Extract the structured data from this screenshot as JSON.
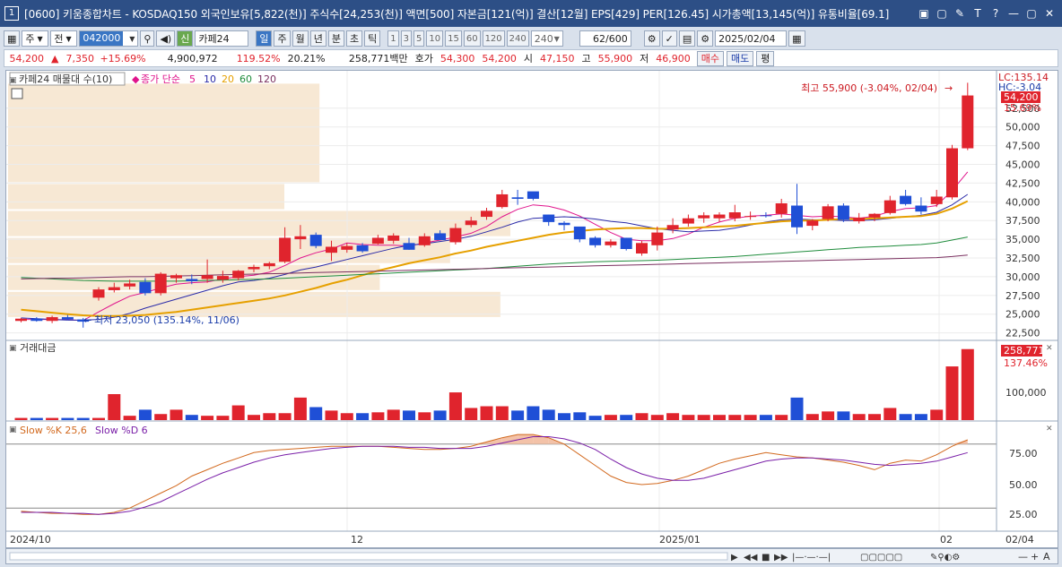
{
  "window": {
    "number": "1",
    "title": "[0600] 키움종합차트 - KOSDAQ150 외국인보유[5,822(천)] 주식수[24,253(천)] 액면[500] 자본금[121(억)] 결산[12월] EPS[429] PER[126.45] 시가총액[13,145(억)] 유통비율[69.1]",
    "buttons": [
      "▣",
      "▢",
      "✎",
      "T",
      "?",
      "—",
      "▢",
      "✕"
    ]
  },
  "toolbar": {
    "period_main": "주",
    "period_prev": "전",
    "code": "042000",
    "shin_label": "신",
    "stock_name": "카페24",
    "period_buttons": [
      "일",
      "주",
      "월",
      "년",
      "분",
      "초",
      "틱"
    ],
    "period_active": "일",
    "interval_buttons": [
      "1",
      "3",
      "5",
      "10",
      "15",
      "60",
      "120",
      "240"
    ],
    "interval_select": "240",
    "count": "62",
    "count_total": "/600",
    "date": "2025/02/04"
  },
  "quote": {
    "price": "54,200",
    "arrow": "▲",
    "change": "7,350",
    "change_rate": "+15.69%",
    "volume": "4,900,972",
    "volume_rate": "119.52%",
    "turnover": "20.21%",
    "amount": "258,771백만",
    "bid_label": "호가",
    "ask": "54,300",
    "bid": "54,200",
    "open_label": "시",
    "open": "47,150",
    "high_label": "고",
    "high": "55,900",
    "low_label": "저",
    "low": "46,900",
    "buy_button": "매수",
    "sell_button": "매도",
    "eval_button": "평"
  },
  "chart": {
    "legend_name": "카페24 매물대 수(10)",
    "ma_label": "종가 단순",
    "ma_periods": [
      "5",
      "10",
      "20",
      "60",
      "120"
    ],
    "ma_colors": [
      "#e0148c",
      "#2a2aa8",
      "#e6a000",
      "#1f8c3c",
      "#7a2f5f"
    ],
    "max_annotation": "최고 55,900 (-3.04%, 02/04)",
    "min_annotation": "최저 23,050 (135.14%, 11/06)",
    "lc_label": "LC:135.14",
    "hc_label": "HC:-3.04",
    "price_badge": "54,200",
    "price_badge_rate": "15.69%",
    "volume_title": "거래대금",
    "volume_badge": "258,771",
    "volume_badge_rate": "137.46%",
    "volume_tick": "100,000",
    "stoch_label_k": "Slow %K 25,6",
    "stoch_label_d": "Slow %D 6",
    "stoch_ticks": [
      "75.00",
      "50.00",
      "25.00"
    ],
    "x_labels": [
      "2024/10",
      "12",
      "2025/01",
      "02",
      "02/04"
    ]
  },
  "chart_data": {
    "type": "candlestick",
    "ylim": [
      21500,
      57500
    ],
    "yticks": [
      "52,500",
      "50,000",
      "47,500",
      "45,000",
      "42,500",
      "40,000",
      "37,500",
      "35,000",
      "32,500",
      "30,000",
      "27,500",
      "25,000",
      "22,500"
    ],
    "candles": [
      [
        24100,
        24500,
        23900,
        24400
      ],
      [
        24400,
        24600,
        24000,
        24100
      ],
      [
        24100,
        24800,
        23800,
        24600
      ],
      [
        24600,
        24900,
        24200,
        24300
      ],
      [
        24300,
        24500,
        23200,
        24000
      ],
      [
        27200,
        28600,
        26800,
        28300
      ],
      [
        28200,
        29200,
        27900,
        28600
      ],
      [
        28700,
        29600,
        28300,
        29100
      ],
      [
        29300,
        29800,
        27500,
        27800
      ],
      [
        27800,
        30600,
        27500,
        30400
      ],
      [
        29800,
        30400,
        29200,
        30200
      ],
      [
        29700,
        30300,
        29000,
        29400
      ],
      [
        29700,
        32300,
        29200,
        30200
      ],
      [
        29600,
        30800,
        29200,
        30100
      ],
      [
        29800,
        30900,
        29500,
        30800
      ],
      [
        31000,
        31600,
        30600,
        31300
      ],
      [
        31400,
        32000,
        31000,
        31800
      ],
      [
        32000,
        36600,
        31800,
        35200
      ],
      [
        35000,
        36900,
        33700,
        35400
      ],
      [
        35600,
        35900,
        33800,
        34100
      ],
      [
        33200,
        34800,
        32100,
        34000
      ],
      [
        33600,
        34500,
        33200,
        34100
      ],
      [
        34200,
        34500,
        33200,
        33400
      ],
      [
        34400,
        35600,
        34300,
        35200
      ],
      [
        34800,
        35800,
        34400,
        35500
      ],
      [
        34500,
        35200,
        33600,
        33600
      ],
      [
        34200,
        35800,
        34000,
        35400
      ],
      [
        35800,
        36200,
        34900,
        34900
      ],
      [
        34600,
        37100,
        34300,
        36500
      ],
      [
        36900,
        38000,
        36600,
        37500
      ],
      [
        38000,
        39200,
        37600,
        38800
      ],
      [
        39300,
        41600,
        39100,
        41000
      ],
      [
        40600,
        41600,
        39600,
        40400
      ],
      [
        41400,
        41300,
        40200,
        40400
      ],
      [
        38300,
        38300,
        36800,
        37300
      ],
      [
        37200,
        37400,
        36200,
        36900
      ],
      [
        36700,
        36500,
        34600,
        35000
      ],
      [
        35200,
        35400,
        33900,
        34200
      ],
      [
        34200,
        35000,
        33900,
        34700
      ],
      [
        35200,
        35200,
        33500,
        33700
      ],
      [
        33100,
        34800,
        32800,
        34500
      ],
      [
        34200,
        36700,
        33500,
        35900
      ],
      [
        36300,
        37800,
        35800,
        36900
      ],
      [
        37100,
        38300,
        36700,
        37800
      ],
      [
        37800,
        38600,
        37200,
        38200
      ],
      [
        37800,
        38600,
        37300,
        38300
      ],
      [
        37800,
        39600,
        37400,
        38600
      ],
      [
        38100,
        38700,
        37600,
        38100
      ],
      [
        38200,
        38600,
        37900,
        38100
      ],
      [
        38400,
        40400,
        37900,
        39800
      ],
      [
        39500,
        42400,
        35700,
        36600
      ],
      [
        36800,
        37700,
        36200,
        37500
      ],
      [
        37700,
        39700,
        37400,
        39400
      ],
      [
        39500,
        39800,
        37300,
        37600
      ],
      [
        37400,
        38500,
        37100,
        37900
      ],
      [
        37900,
        38500,
        37400,
        38400
      ],
      [
        38500,
        40800,
        38300,
        40200
      ],
      [
        40800,
        41600,
        39500,
        39700
      ],
      [
        39500,
        40600,
        38300,
        38700
      ],
      [
        39700,
        41600,
        39300,
        40700
      ],
      [
        40600,
        47600,
        40300,
        47150
      ],
      [
        47150,
        55900,
        46900,
        54200
      ]
    ],
    "amounts": [
      2.5,
      2.5,
      2.5,
      2.5,
      2.5,
      2.5,
      30,
      5,
      12,
      7,
      12,
      6,
      5,
      5,
      17,
      6,
      8,
      8,
      26,
      15,
      11,
      8,
      8,
      9,
      12,
      11,
      9,
      11,
      32,
      14,
      16,
      16,
      11,
      16,
      12,
      8,
      9,
      5,
      6,
      6,
      8,
      6,
      8,
      6,
      6,
      6,
      6,
      6,
      6,
      6,
      26,
      7,
      10,
      10,
      7,
      7,
      14,
      7,
      7,
      12,
      62,
      82
    ],
    "ma": {
      "5": [
        24300,
        24300,
        24300,
        24250,
        24150,
        25300,
        26400,
        27400,
        27900,
        28500,
        29000,
        29200,
        29300,
        29700,
        30000,
        30200,
        30600,
        31500,
        32500,
        33200,
        33700,
        34500,
        34300,
        34200,
        34200,
        34100,
        34500,
        34900,
        35300,
        35800,
        36700,
        38000,
        39000,
        39600,
        39400,
        38900,
        38100,
        37000,
        35900,
        35000,
        34800,
        34800,
        35100,
        35700,
        36600,
        37300,
        37800,
        38100,
        38200,
        38400,
        38200,
        38000,
        38100,
        38000,
        37800,
        38100,
        38700,
        39100,
        39200,
        39500,
        41500,
        44000
      ],
      "10": [
        24500,
        24400,
        24300,
        24200,
        24200,
        24300,
        24600,
        25100,
        25800,
        26400,
        27000,
        27600,
        28200,
        28800,
        29300,
        29500,
        29800,
        30300,
        30900,
        31300,
        31800,
        32300,
        32800,
        33300,
        33800,
        34200,
        34400,
        34700,
        35000,
        35400,
        36000,
        36600,
        37300,
        37800,
        37900,
        38000,
        37900,
        37700,
        37400,
        37200,
        36800,
        36400,
        36200,
        36000,
        36100,
        36200,
        36500,
        36900,
        37300,
        37600,
        37700,
        37600,
        37600,
        37500,
        37500,
        37600,
        37800,
        38000,
        38200,
        38600,
        39600,
        41000
      ],
      "20": [
        25600,
        25400,
        25200,
        25000,
        24850,
        24750,
        24750,
        24800,
        24900,
        25100,
        25300,
        25600,
        25900,
        26200,
        26500,
        26800,
        27100,
        27500,
        28000,
        28500,
        29100,
        29600,
        30200,
        30800,
        31300,
        31800,
        32200,
        32600,
        33100,
        33500,
        34000,
        34400,
        34800,
        35200,
        35600,
        35900,
        36100,
        36300,
        36400,
        36500,
        36500,
        36400,
        36400,
        36500,
        36600,
        36700,
        36800,
        37000,
        37200,
        37400,
        37500,
        37500,
        37600,
        37700,
        37700,
        37800,
        37900,
        38000,
        38100,
        38400,
        39100,
        40100
      ],
      "60": [
        29900,
        29800,
        29700,
        29600,
        29500,
        29450,
        29400,
        29400,
        29400,
        29400,
        29400,
        29450,
        29500,
        29550,
        29600,
        29650,
        29700,
        29800,
        29900,
        30000,
        30100,
        30200,
        30300,
        30400,
        30500,
        30600,
        30700,
        30800,
        30900,
        31000,
        31100,
        31250,
        31400,
        31550,
        31700,
        31800,
        31900,
        32000,
        32050,
        32100,
        32150,
        32200,
        32300,
        32400,
        32500,
        32600,
        32700,
        32850,
        33000,
        33150,
        33300,
        33450,
        33600,
        33750,
        33900,
        34000,
        34100,
        34200,
        34300,
        34500,
        34900,
        35300
      ],
      "120": [
        29700,
        29750,
        29800,
        29800,
        29850,
        29900,
        29950,
        30000,
        30000,
        30050,
        30100,
        30150,
        30200,
        30250,
        30300,
        30350,
        30400,
        30450,
        30500,
        30550,
        30600,
        30650,
        30700,
        30750,
        30800,
        30850,
        30900,
        30950,
        31000,
        31050,
        31100,
        31150,
        31200,
        31250,
        31300,
        31350,
        31400,
        31450,
        31500,
        31550,
        31600,
        31650,
        31700,
        31750,
        31800,
        31850,
        31900,
        31950,
        32000,
        32050,
        32100,
        32150,
        32200,
        32250,
        32300,
        32350,
        32400,
        32450,
        32500,
        32550,
        32700,
        32900
      ]
    },
    "stoch_k": [
      17,
      16,
      15,
      15,
      14,
      14,
      16,
      20,
      27,
      34,
      41,
      50,
      56,
      62,
      67,
      72,
      74,
      75,
      76,
      77,
      78,
      78,
      78,
      78,
      77,
      76,
      75,
      75,
      76,
      78,
      82,
      86,
      89,
      89,
      86,
      80,
      70,
      60,
      50,
      44,
      42,
      43,
      46,
      50,
      56,
      62,
      66,
      69,
      72,
      70,
      68,
      67,
      65,
      63,
      60,
      56,
      62,
      65,
      64,
      70,
      78,
      84
    ],
    "stoch_d": [
      16,
      16,
      16,
      15,
      15,
      14,
      15,
      17,
      21,
      26,
      33,
      40,
      47,
      53,
      58,
      63,
      67,
      70,
      72,
      74,
      76,
      77,
      78,
      78,
      78,
      77,
      77,
      76,
      76,
      76,
      78,
      81,
      84,
      87,
      87,
      85,
      81,
      75,
      66,
      58,
      52,
      48,
      46,
      46,
      48,
      52,
      56,
      60,
      64,
      66,
      67,
      67,
      66,
      65,
      63,
      61,
      60,
      61,
      62,
      64,
      68,
      72
    ],
    "volume_profile": [
      {
        "low": 42500,
        "high": 55900,
        "value": 0.62
      },
      {
        "low": 38900,
        "high": 42500,
        "value": 0.55
      },
      {
        "low": 35300,
        "high": 38900,
        "value": 1.0
      },
      {
        "low": 31700,
        "high": 35300,
        "value": 0.88
      },
      {
        "low": 28100,
        "high": 31700,
        "value": 0.74
      },
      {
        "low": 24500,
        "high": 28100,
        "value": 0.98
      }
    ]
  }
}
